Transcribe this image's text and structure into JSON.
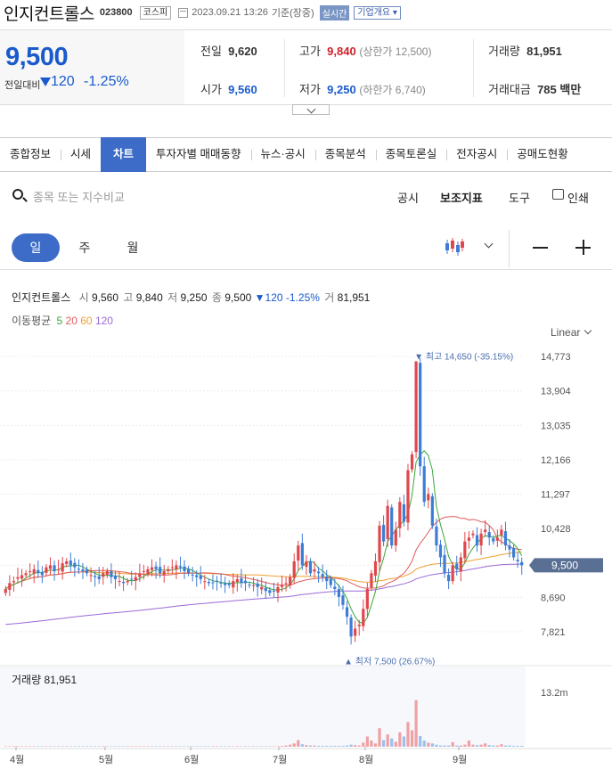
{
  "header": {
    "name": "인지컨트롤스",
    "code": "023800",
    "market": "코스피",
    "datetime": "2023.09.21 13:26",
    "basis": "기준(장중)",
    "realtime": "실시간",
    "company_overview": "기업개요"
  },
  "price": {
    "current": "9,500",
    "change_label": "전일대비",
    "change": "120",
    "change_pct": "-1.25%"
  },
  "info": {
    "prev_label": "전일",
    "prev": "9,620",
    "high_label": "고가",
    "high": "9,840",
    "upper_limit": "(상한가 12,500)",
    "volume_label": "거래량",
    "volume": "81,951",
    "open_label": "시가",
    "open": "9,560",
    "low_label": "저가",
    "low": "9,250",
    "lower_limit": "(하한가 6,740)",
    "amount_label": "거래대금",
    "amount": "785 백만"
  },
  "tabs": [
    "종합정보",
    "시세",
    "차트",
    "투자자별 매매동향",
    "뉴스·공시",
    "종목분석",
    "종목토론실",
    "전자공시",
    "공매도현황"
  ],
  "toolbar": {
    "search_placeholder": "종목 또는 지수비교",
    "disclosure": "공시",
    "indicator": "보조지표",
    "tools": "도구",
    "print": "인쇄"
  },
  "periods": [
    "일",
    "주",
    "월"
  ],
  "legend": {
    "name": "인지컨트롤스",
    "open_k": "시",
    "open": "9,560",
    "high_k": "고",
    "high": "9,840",
    "low_k": "저",
    "low": "9,250",
    "close_k": "종",
    "close": "9,500",
    "change": "▼120 -1.25%",
    "vol_k": "거",
    "vol": "81,951",
    "ma_label": "이동평균",
    "ma": [
      "5",
      "20",
      "60",
      "120"
    ]
  },
  "scale": "Linear",
  "colors": {
    "up": "#e0474c",
    "down": "#3d7dd6",
    "ma5": "#3aa83a",
    "ma20": "#e05a5a",
    "ma60": "#f0a030",
    "ma120": "#9a6ad8",
    "accent": "#3c6cc8"
  },
  "chart_data": {
    "type": "candlestick",
    "price_ticks": [
      "14,773",
      "13,904",
      "13,035",
      "12,166",
      "11,297",
      "10,428",
      "9,500",
      "8,690",
      "7,821"
    ],
    "months": [
      "4월",
      "5월",
      "6월",
      "7월",
      "8월",
      "9월"
    ],
    "max_annotation": "최고 14,650 (-35.15%)",
    "min_annotation": "최저 7,500 (26.67%)",
    "current_price": "9,500",
    "volume_label": "거래량 81,951",
    "volume_tick": "13.2m",
    "closes": [
      8900,
      9050,
      9100,
      9200,
      9250,
      9300,
      9350,
      9400,
      9300,
      9250,
      9450,
      9500,
      9350,
      9400,
      9550,
      9600,
      9500,
      9450,
      9400,
      9350,
      9300,
      9250,
      9200,
      9150,
      9300,
      9350,
      9200,
      9150,
      9100,
      9050,
      9100,
      9150,
      9200,
      9300,
      9350,
      9400,
      9450,
      9400,
      9300,
      9350,
      9400,
      9450,
      9500,
      9450,
      9350,
      9300,
      9250,
      9200,
      9150,
      9100,
      9050,
      9050,
      9100,
      9050,
      9000,
      9000,
      9100,
      9150,
      9050,
      9050,
      9000,
      9000,
      8950,
      8950,
      8850,
      8800,
      8850,
      8950,
      9000,
      9050,
      9200,
      9600,
      10000,
      9500,
      9600,
      9300,
      9400,
      9300,
      9200,
      9100,
      9000,
      8900,
      8700,
      8500,
      8200,
      7700,
      7900,
      8000,
      8400,
      8900,
      9300,
      9600,
      10500,
      10100,
      11000,
      10000,
      10400,
      11100,
      10600,
      11900,
      12300,
      14650,
      12000,
      11100,
      11300,
      10500,
      10000,
      9700,
      9300,
      9100,
      9500,
      9400,
      9700,
      10100,
      10200,
      10300,
      10000,
      10300,
      10400,
      10200,
      10100,
      10200,
      10400,
      10000,
      9900,
      9700,
      9600,
      9500
    ],
    "volumes": [
      0.1,
      0.1,
      0.1,
      0.1,
      0.1,
      0.1,
      0.1,
      0.1,
      0.1,
      0.1,
      0.1,
      0.1,
      0.1,
      0.1,
      0.1,
      0.1,
      0.1,
      0.1,
      0.1,
      0.1,
      0.1,
      0.1,
      0.1,
      0.1,
      0.1,
      0.1,
      0.1,
      0.1,
      0.1,
      0.1,
      0.1,
      0.1,
      0.1,
      0.1,
      0.1,
      0.1,
      0.1,
      0.1,
      0.1,
      0.1,
      0.1,
      0.1,
      0.1,
      0.1,
      0.1,
      0.1,
      0.1,
      0.1,
      0.1,
      0.1,
      0.1,
      0.1,
      0.1,
      0.1,
      0.1,
      0.1,
      0.1,
      0.1,
      0.1,
      0.1,
      0.1,
      0.1,
      0.1,
      0.1,
      0.1,
      0.1,
      0.1,
      0.1,
      0.2,
      0.3,
      0.5,
      0.8,
      1.6,
      0.6,
      0.4,
      0.3,
      0.3,
      0.2,
      0.2,
      0.2,
      0.2,
      0.2,
      0.2,
      0.2,
      0.3,
      0.5,
      0.4,
      0.3,
      1.0,
      2.5,
      1.5,
      0.8,
      4.5,
      1.6,
      3.0,
      2.0,
      1.2,
      3.5,
      2.5,
      6.0,
      4.0,
      11.3,
      2.6,
      1.5,
      1.0,
      0.8,
      0.5,
      0.3,
      0.3,
      0.3,
      1.1,
      0.3,
      0.3,
      0.5,
      1.5,
      0.5,
      0.4,
      0.5,
      0.8,
      0.4,
      0.3,
      0.3,
      0.6,
      0.3,
      0.3,
      0.2,
      0.2,
      0.2
    ]
  }
}
